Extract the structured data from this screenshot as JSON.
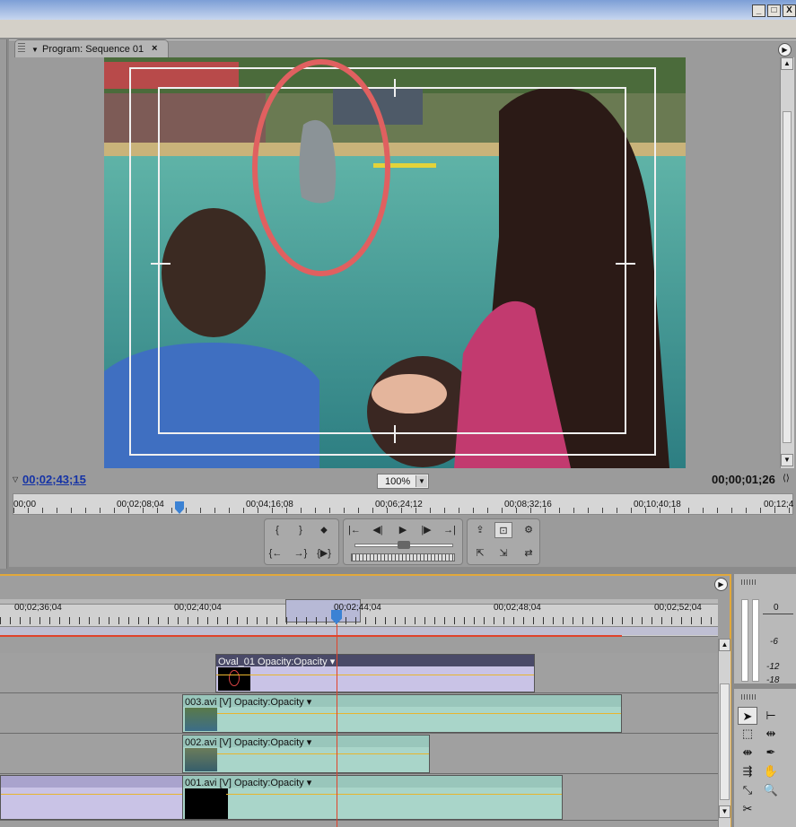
{
  "window": {
    "buttons": [
      "_",
      "□",
      "X"
    ]
  },
  "program_monitor": {
    "tab_title": "Program: Sequence 01",
    "close": "×",
    "current_timecode": "00;02;43;15",
    "duration_timecode": "00;00;01;26",
    "zoom": "100%",
    "ruler_labels": [
      "00;00",
      "00;02;08;04",
      "00;04;16;08",
      "00;06;24;12",
      "00;08;32;16",
      "00;10;40;18",
      "00;12;4"
    ]
  },
  "transport": {
    "row1_group1": [
      "{",
      "}",
      "⬥"
    ],
    "row2_group1": [
      "{←",
      "→}",
      "{▶}"
    ],
    "row1_group2": [
      "|←",
      "◀|",
      "▶",
      "|▶",
      "→|"
    ],
    "row1_group3": [
      "⇪",
      "⊡",
      "⚙"
    ],
    "row2_group3": [
      "⇱",
      "⇲",
      "⇄"
    ]
  },
  "timeline": {
    "ruler_labels": [
      "00;02;36;04",
      "00;02;40;04",
      "00;02;44;04",
      "00;02;48;04",
      "00;02;52;04"
    ],
    "clips": {
      "v4": "Oval_01  Opacity:Opacity ▾",
      "v3": "003.avi [V]  Opacity:Opacity ▾",
      "v2": "002.avi [V]  Opacity:Opacity ▾",
      "v1": "001.avi [V]  Opacity:Opacity ▾"
    }
  },
  "audio_meter": {
    "labels": [
      "0",
      "-6",
      "-12",
      "-18"
    ]
  },
  "tools": {
    "icons": [
      "selection-tool-icon",
      "track-select-tool-icon",
      "ripple-edit-tool-icon",
      "rolling-edit-tool-icon",
      "rate-stretch-tool-icon",
      "razor-tool-icon",
      "slip-tool-icon",
      "slide-tool-icon",
      "pen-tool-icon",
      "hand-tool-icon",
      "zoom-tool-icon"
    ]
  },
  "colors": {
    "accent_orange": "#e2a83a",
    "playhead": "#e0432b",
    "timecode_blue": "#1533a6",
    "clip_teal": "#a9d5c9",
    "clip_lavender": "#c9c3e6",
    "overlay_ellipse": "#e06060"
  }
}
